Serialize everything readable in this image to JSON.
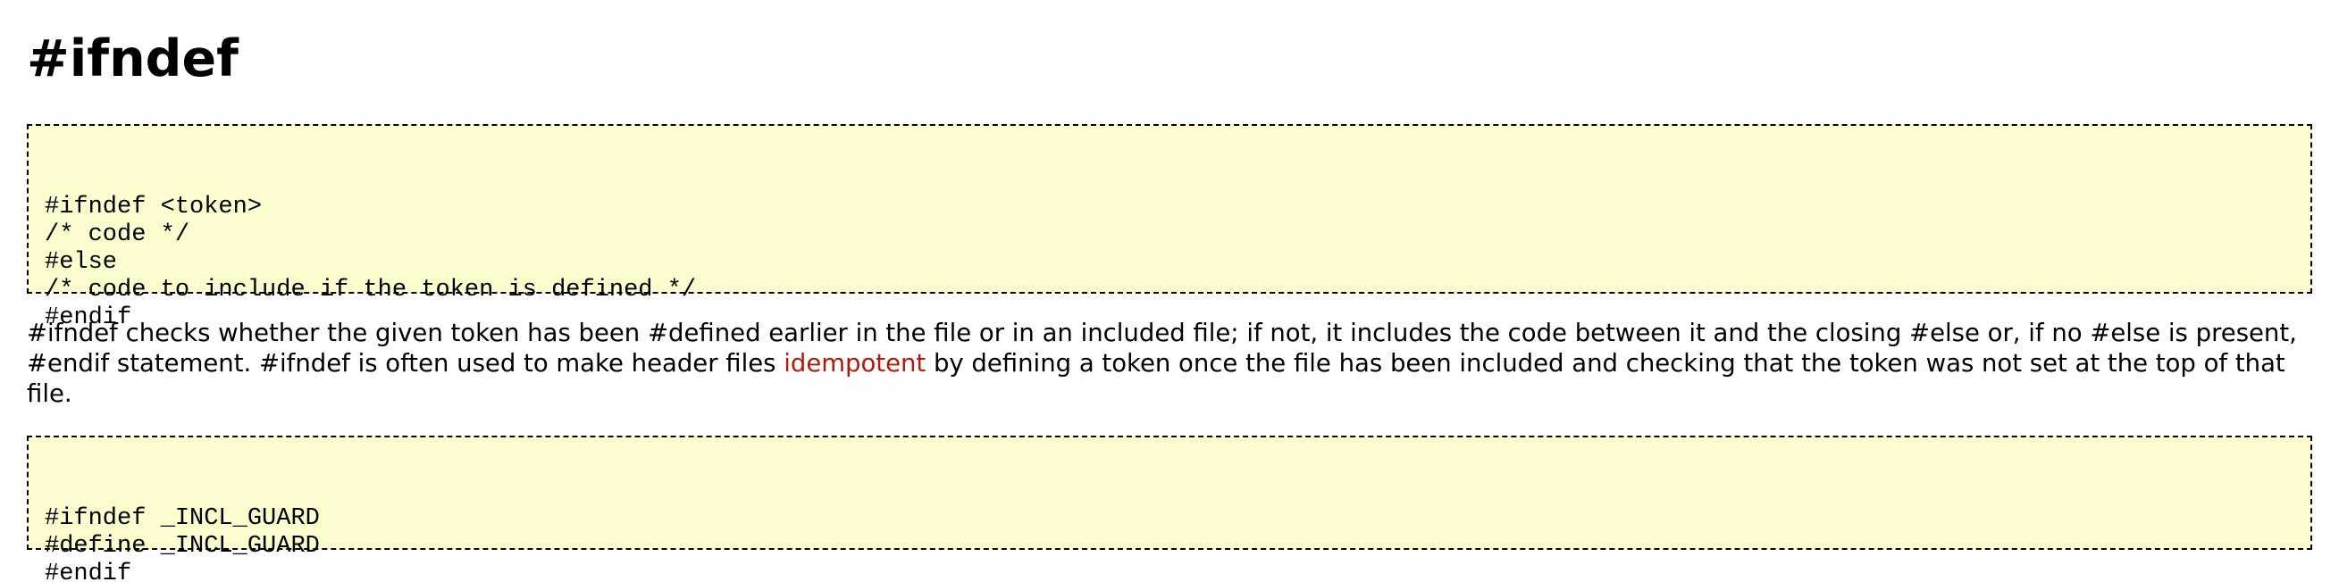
{
  "heading": "#ifndef",
  "code_blocks": [
    {
      "lines": [
        "#ifndef <token>",
        "/* code */",
        "#else",
        "/* code to include if the token is defined */",
        "#endif"
      ]
    },
    {
      "lines": [
        "#ifndef _INCL_GUARD",
        "#define _INCL_GUARD",
        "#endif"
      ]
    }
  ],
  "paragraph": {
    "before_link": "#ifndef checks whether the given token has been #defined earlier in the file or in an included file; if not, it includes the code between it and the closing #else or, if no #else is present, #endif statement. #ifndef is often used to make header files ",
    "link_text": "idempotent",
    "after_link": " by defining a token once the file has been included and checking that the token was not set at the top of that file."
  },
  "colors": {
    "code_background": "#fdfdd0",
    "link": "#b21b0c",
    "text": "#000000"
  }
}
